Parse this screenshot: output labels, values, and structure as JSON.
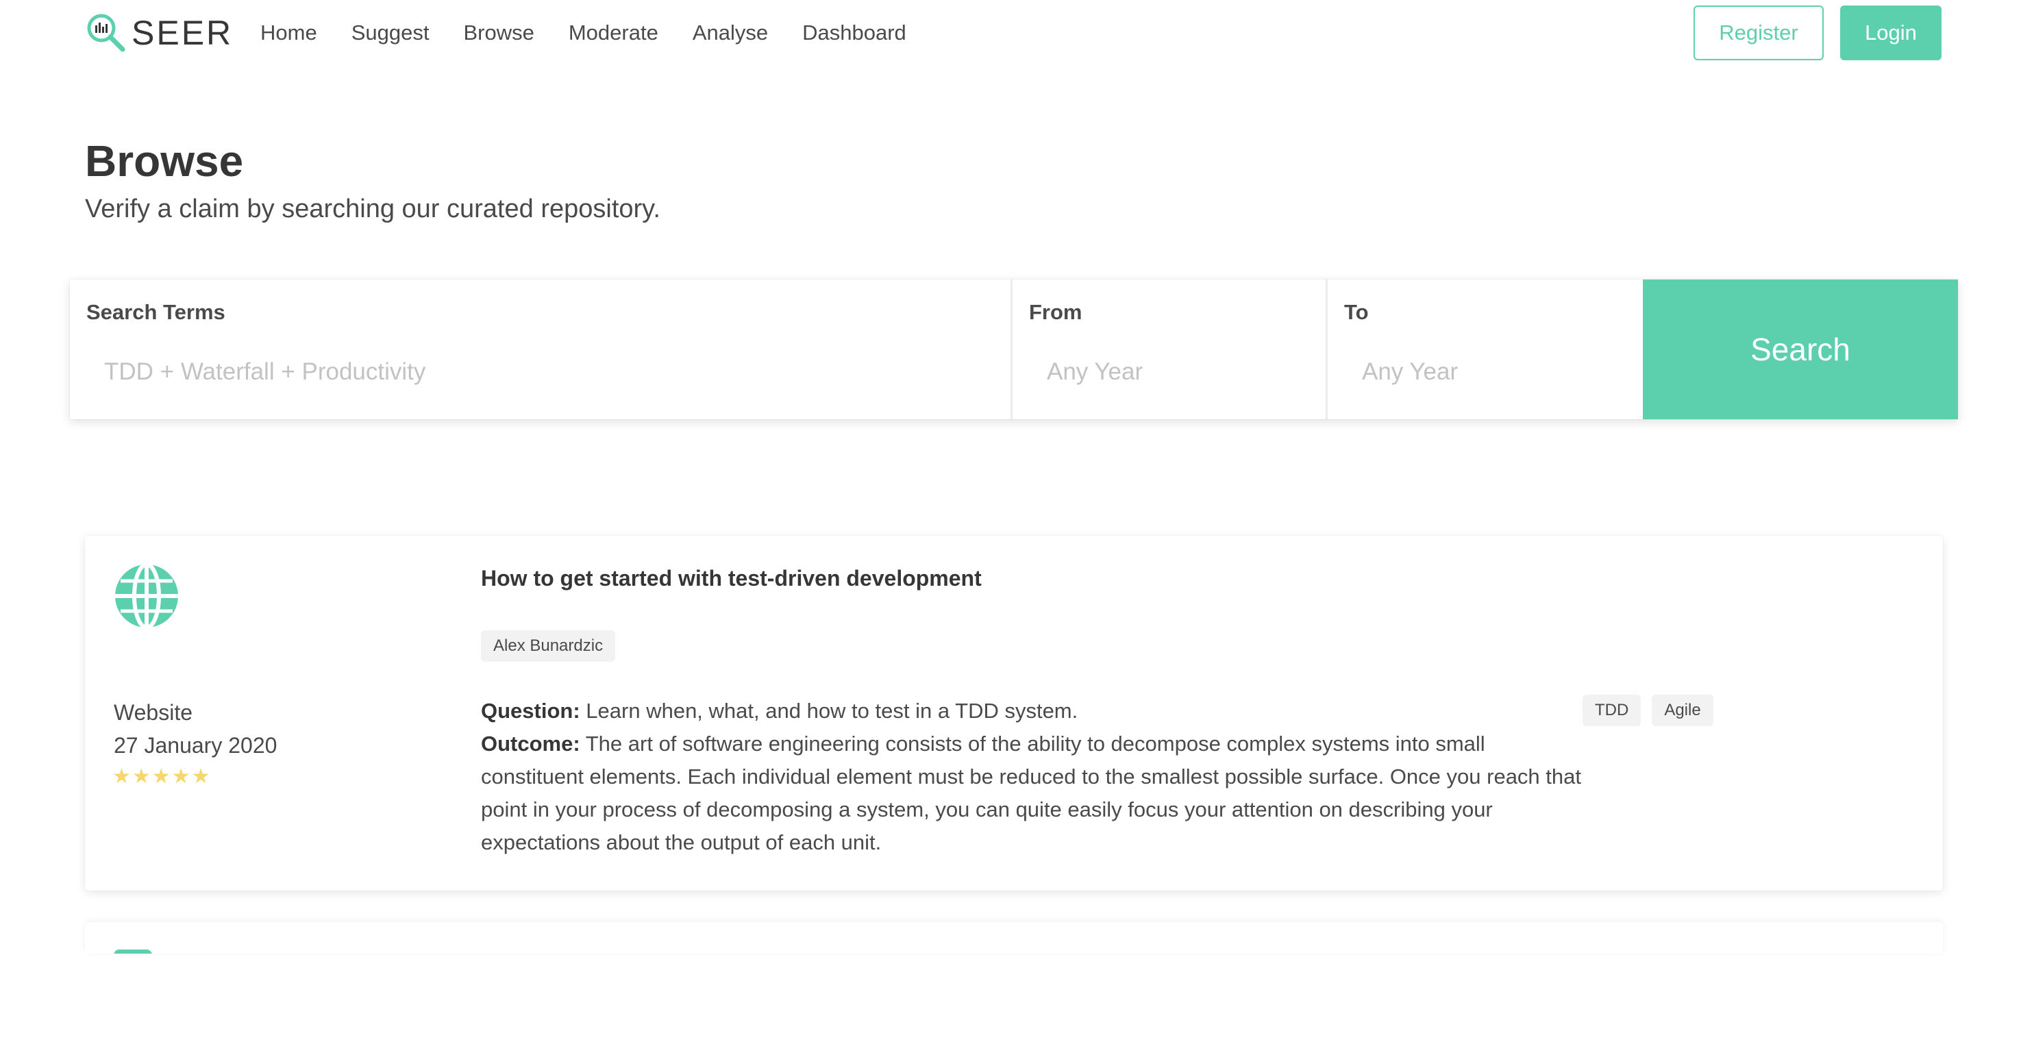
{
  "brand": {
    "name": "SEER",
    "icon": "magnifier-chart-icon",
    "accent": "#5ccfac"
  },
  "nav": {
    "items": [
      "Home",
      "Suggest",
      "Browse",
      "Moderate",
      "Analyse",
      "Dashboard"
    ]
  },
  "auth": {
    "register_label": "Register",
    "login_label": "Login"
  },
  "hero": {
    "title": "Browse",
    "subtitle": "Verify a claim by searching our curated repository."
  },
  "search": {
    "terms_label": "Search Terms",
    "terms_placeholder": "TDD + Waterfall + Productivity",
    "terms_value": "",
    "from_label": "From",
    "from_placeholder": "Any Year",
    "from_value": "",
    "to_label": "To",
    "to_placeholder": "Any Year",
    "to_value": "",
    "button_label": "Search"
  },
  "results": [
    {
      "icon": "globe-icon",
      "type": "Website",
      "date": "27 January 2020",
      "rating": 5,
      "stars": "★★★★★",
      "title": "How to get started with test-driven development",
      "author": "Alex Bunardzic",
      "question_label": "Question:",
      "question": "Learn when, what, and how to test in a TDD system.",
      "outcome_label": "Outcome:",
      "outcome": "The art of software engineering consists of the ability to decompose complex systems into small constituent elements. Each individual element must be reduced to the smallest possible surface. Once you reach that point in your process of decomposing a system, you can quite easily focus your attention on describing your expectations about the output of each unit.",
      "tags": [
        "TDD",
        "Agile"
      ]
    }
  ]
}
